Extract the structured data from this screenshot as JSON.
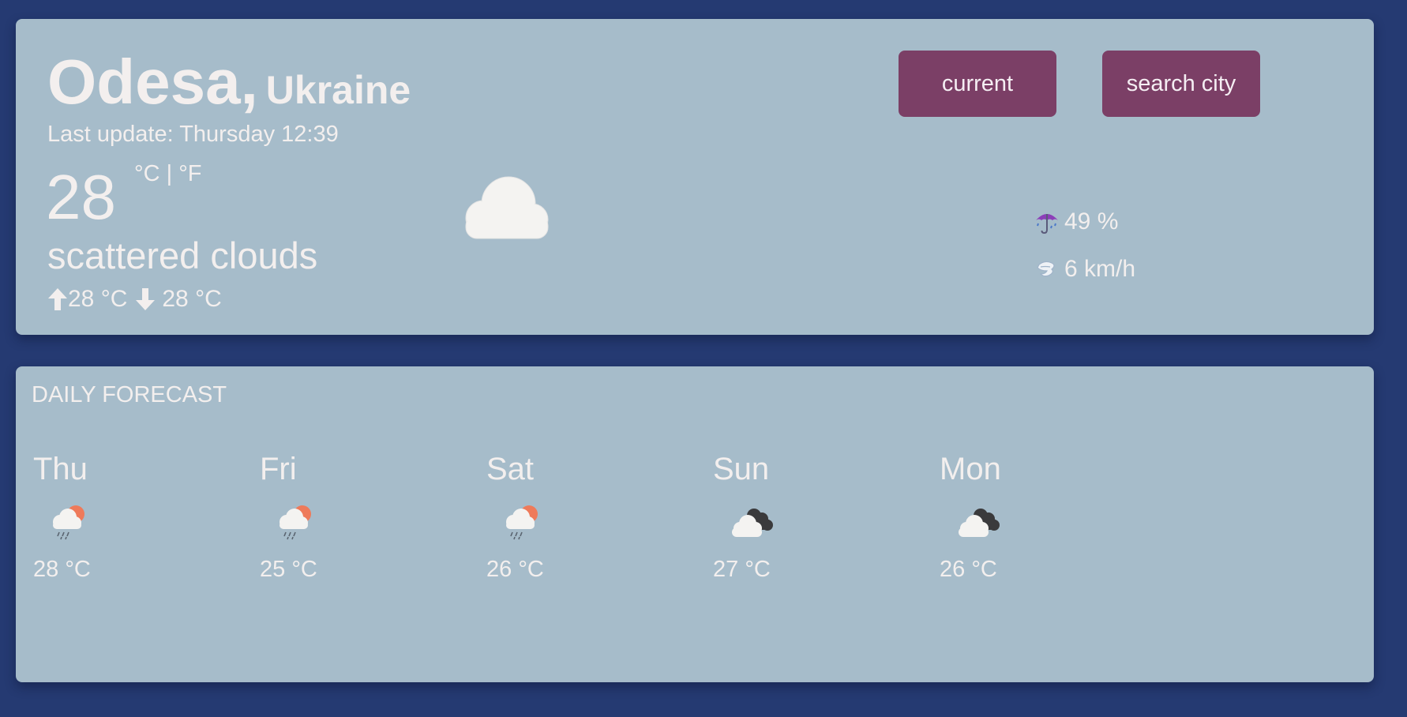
{
  "current": {
    "city": "Odesa,",
    "country": "Ukraine",
    "last_update_label": "Last update:",
    "last_update_value": "Thursday 12:39",
    "temperature": "28",
    "units": "°C | °F",
    "description": "scattered clouds",
    "max_temp": "28 °C",
    "min_temp": "28 °C",
    "icon": "cloud-icon",
    "precipitation": "49 %",
    "precipitation_icon": "umbrella-icon",
    "wind": "6 km/h",
    "wind_icon": "wind-icon"
  },
  "buttons": {
    "current_label": "current",
    "search_label": "search city",
    "color": "#7b3f66"
  },
  "forecast": {
    "title": "DAILY FORECAST",
    "days": [
      {
        "day": "Thu",
        "temp": "28 °C",
        "icon": "sun-rain-cloud-icon"
      },
      {
        "day": "Fri",
        "temp": "25 °C",
        "icon": "sun-rain-cloud-icon"
      },
      {
        "day": "Sat",
        "temp": "26 °C",
        "icon": "sun-rain-cloud-icon"
      },
      {
        "day": "Sun",
        "temp": "27 °C",
        "icon": "broken-clouds-icon"
      },
      {
        "day": "Mon",
        "temp": "26 °C",
        "icon": "broken-clouds-icon"
      }
    ]
  },
  "colors": {
    "background": "#253a72",
    "card": "#a6bcca",
    "text": "#f3efee",
    "accent": "#7b3f66"
  }
}
